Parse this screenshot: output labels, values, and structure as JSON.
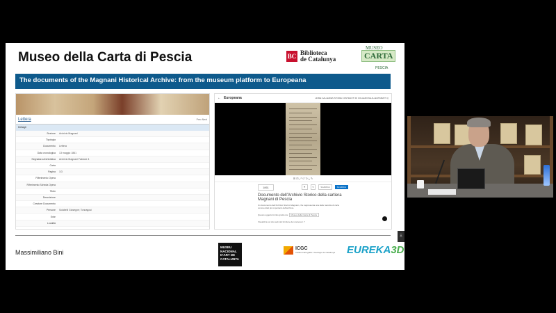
{
  "slide": {
    "title": "Museo della Carta di Pescia",
    "banner": "The documents of the Magnani Historical Archive: from the museum platform to Europeana",
    "presenter": "Massimiliano Bini",
    "logos": {
      "biblioteca_mark": "BC",
      "biblioteca_line1": "Biblioteca",
      "biblioteca_line2": "de Catalunya",
      "museo_line1": "MUSEO",
      "museo_line2": "CARTA",
      "museo_line3": "PESCIA",
      "mnac": [
        "MUSEU",
        "NACIONAL",
        "D'ART DE",
        "CATALUNYA"
      ],
      "icgc": "ICGC",
      "icgc_sub": "Institut Cartogràfic i Geològic de Catalunya",
      "eureka_word": "EUREKA",
      "eureka_num": "3D"
    },
    "side_tab": "Ξ"
  },
  "left_panel": {
    "record_title": "Lettera",
    "record_buttons": "Prev  Next",
    "selected": "Dettagli",
    "fields": [
      {
        "key": "Sezione",
        "value": "Archivio Magnani"
      },
      {
        "key": "Tipologia",
        "value": ""
      },
      {
        "key": "Documento",
        "value": "Lettera"
      },
      {
        "key": "Data cronologica",
        "value": "13 maggio 1861"
      },
      {
        "key": "Segnatura Archivistica",
        "value": "Archivio Magnani Faldone 4"
      },
      {
        "key": "Carta",
        "value": ""
      },
      {
        "key": "Pagina",
        "value": "1/3"
      },
      {
        "key": "Riferimento Opera",
        "value": ""
      },
      {
        "key": "Riferimento Scheda Opera",
        "value": ""
      },
      {
        "key": "Titolo",
        "value": ""
      },
      {
        "key": "Descrizione",
        "value": ""
      },
      {
        "key": "Creatore Documento",
        "value": ""
      },
      {
        "key": "Persone",
        "value": "Sciabelli Giuseppe; Tonnagosi"
      },
      {
        "key": "Ente",
        "value": ""
      },
      {
        "key": "Località",
        "value": ""
      }
    ]
  },
  "right_panel": {
    "back": "←",
    "logo": "Europeana",
    "nav_links": "HOME   GALLERIES   STORIE   CONTENUTI DI COLLEZIONE   ALLESTIMENTI   Q",
    "viewer_tools": "⊞  ⊟  ⤢  ↺  ↻  ⤓  ✎",
    "year": "1861",
    "chip1": "⚑",
    "chip2": "♥",
    "chip3": "SCARICA",
    "download": "SCARICA",
    "doc_title": "Documento dell'Archivio Storico della cartiera Magnani di Pescia",
    "doc_desc": "Un documento dell'Archivio Storico Magnani, che rappresenta una delle raccolte di carte commerciali più importanti dell'archivio.",
    "link_label": "Questo oggetto fornito grazie da:",
    "link_value": "Museo della Carta di Pescia",
    "more": "Visualizza sul sito web del fornitore dei contenuti ↗"
  }
}
